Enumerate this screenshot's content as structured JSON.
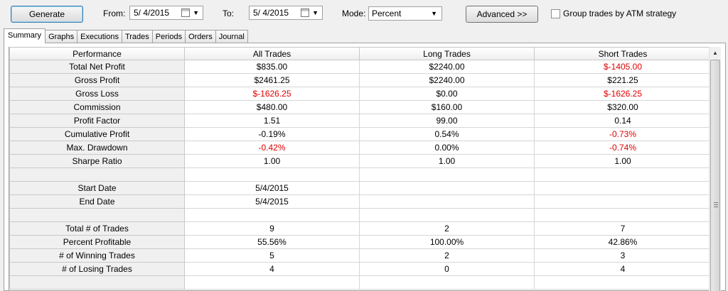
{
  "toolbar": {
    "generate_label": "Generate",
    "from_label": "From:",
    "from_value": "5/ 4/2015",
    "to_label": "To:",
    "to_value": "5/ 4/2015",
    "mode_label": "Mode:",
    "mode_value": "Percent",
    "advanced_label": "Advanced >>",
    "group_checkbox_label": "Group trades by ATM strategy",
    "group_checked": false
  },
  "tabs": [
    "Summary",
    "Graphs",
    "Executions",
    "Trades",
    "Periods",
    "Orders",
    "Journal"
  ],
  "active_tab": "Summary",
  "table": {
    "headers": [
      "Performance",
      "All Trades",
      "Long Trades",
      "Short Trades"
    ],
    "rows": [
      {
        "name": "Total Net Profit",
        "all": "$835.00",
        "long": "$2240.00",
        "short": "$-1405.00",
        "neg": [
          false,
          false,
          true
        ]
      },
      {
        "name": "Gross Profit",
        "all": "$2461.25",
        "long": "$2240.00",
        "short": "$221.25",
        "neg": [
          false,
          false,
          false
        ]
      },
      {
        "name": "Gross Loss",
        "all": "$-1626.25",
        "long": "$0.00",
        "short": "$-1626.25",
        "neg": [
          true,
          false,
          true
        ]
      },
      {
        "name": "Commission",
        "all": "$480.00",
        "long": "$160.00",
        "short": "$320.00",
        "neg": [
          false,
          false,
          false
        ]
      },
      {
        "name": "Profit Factor",
        "all": "1.51",
        "long": "99.00",
        "short": "0.14",
        "neg": [
          false,
          false,
          false
        ]
      },
      {
        "name": "Cumulative Profit",
        "all": "-0.19%",
        "long": "0.54%",
        "short": "-0.73%",
        "neg": [
          false,
          false,
          true
        ]
      },
      {
        "name": "Max. Drawdown",
        "all": "-0.42%",
        "long": "0.00%",
        "short": "-0.74%",
        "neg": [
          true,
          false,
          true
        ]
      },
      {
        "name": "Sharpe Ratio",
        "all": "1.00",
        "long": "1.00",
        "short": "1.00",
        "neg": [
          false,
          false,
          false
        ]
      },
      {
        "name": "",
        "all": "",
        "long": "",
        "short": "",
        "neg": [
          false,
          false,
          false
        ]
      },
      {
        "name": "Start Date",
        "all": "5/4/2015",
        "long": "",
        "short": "",
        "neg": [
          false,
          false,
          false
        ]
      },
      {
        "name": "End Date",
        "all": "5/4/2015",
        "long": "",
        "short": "",
        "neg": [
          false,
          false,
          false
        ]
      },
      {
        "name": "",
        "all": "",
        "long": "",
        "short": "",
        "neg": [
          false,
          false,
          false
        ]
      },
      {
        "name": "Total # of Trades",
        "all": "9",
        "long": "2",
        "short": "7",
        "neg": [
          false,
          false,
          false
        ]
      },
      {
        "name": "Percent Profitable",
        "all": "55.56%",
        "long": "100.00%",
        "short": "42.86%",
        "neg": [
          false,
          false,
          false
        ]
      },
      {
        "name": "# of Winning Trades",
        "all": "5",
        "long": "2",
        "short": "3",
        "neg": [
          false,
          false,
          false
        ]
      },
      {
        "name": "# of Losing Trades",
        "all": "4",
        "long": "0",
        "short": "4",
        "neg": [
          false,
          false,
          false
        ]
      },
      {
        "name": "",
        "all": "",
        "long": "",
        "short": "",
        "neg": [
          false,
          false,
          false
        ]
      }
    ]
  },
  "colors": {
    "negative": "#e00000",
    "header_bg": "#f0f0f0"
  }
}
